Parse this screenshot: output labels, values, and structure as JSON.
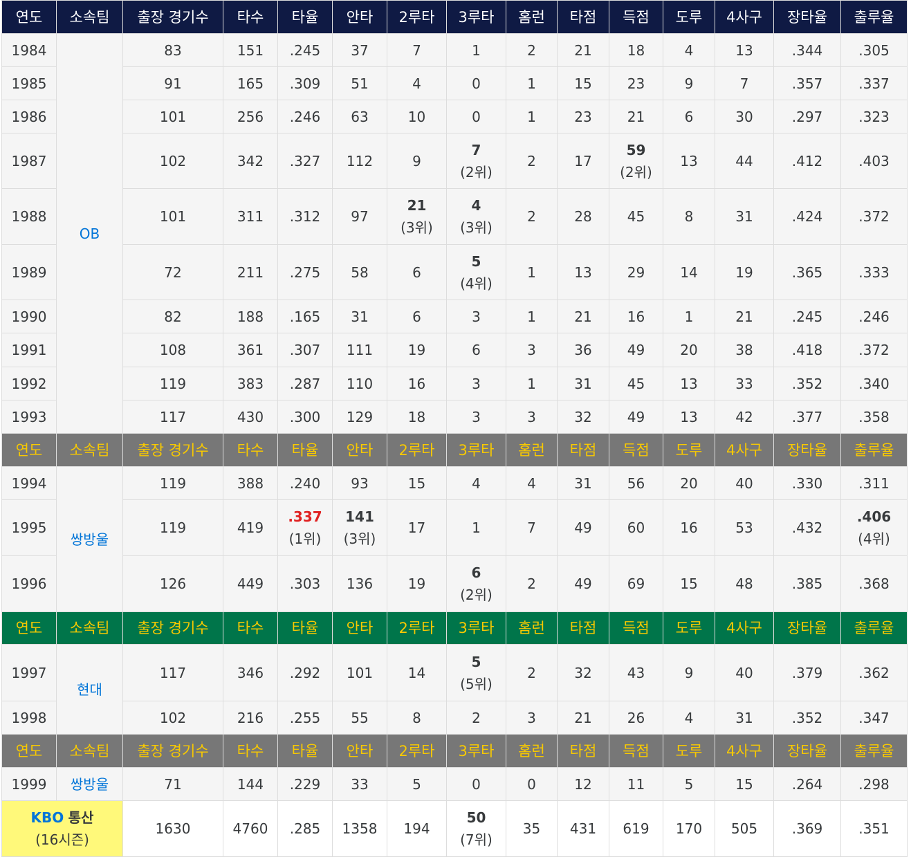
{
  "headers": [
    "연도",
    "소속팀",
    "출장 경기수",
    "타수",
    "타율",
    "안타",
    "2루타",
    "3루타",
    "홈런",
    "타점",
    "득점",
    "도루",
    "4사구",
    "장타율",
    "출루율"
  ],
  "groups": [
    {
      "team": "OB",
      "rows": [
        [
          "1984",
          "83",
          "151",
          ".245",
          "37",
          "7",
          "1",
          "2",
          "21",
          "18",
          "4",
          "13",
          ".344",
          ".305"
        ],
        [
          "1985",
          "91",
          "165",
          ".309",
          "51",
          "4",
          "0",
          "1",
          "15",
          "23",
          "9",
          "7",
          ".357",
          ".337"
        ],
        [
          "1986",
          "101",
          "256",
          ".246",
          "63",
          "10",
          "0",
          "1",
          "23",
          "21",
          "6",
          "30",
          ".297",
          ".323"
        ],
        [
          "1987",
          "102",
          "342",
          ".327",
          "112",
          "9",
          {
            "v": "7",
            "rank": "(2위)"
          },
          "2",
          "17",
          {
            "v": "59",
            "rank": "(2위)"
          },
          "13",
          "44",
          ".412",
          ".403"
        ],
        [
          "1988",
          "101",
          "311",
          ".312",
          "97",
          {
            "v": "21",
            "rank": "(3위)"
          },
          {
            "v": "4",
            "rank": "(3위)"
          },
          "2",
          "28",
          "45",
          "8",
          "31",
          ".424",
          ".372"
        ],
        [
          "1989",
          "72",
          "211",
          ".275",
          "58",
          "6",
          {
            "v": "5",
            "rank": "(4위)"
          },
          "1",
          "13",
          "29",
          "14",
          "19",
          ".365",
          ".333"
        ],
        [
          "1990",
          "82",
          "188",
          ".165",
          "31",
          "6",
          "3",
          "1",
          "21",
          "16",
          "1",
          "21",
          ".245",
          ".246"
        ],
        [
          "1991",
          "108",
          "361",
          ".307",
          "111",
          "19",
          "6",
          "3",
          "36",
          "49",
          "20",
          "38",
          ".418",
          ".372"
        ],
        [
          "1992",
          "119",
          "383",
          ".287",
          "110",
          "16",
          "3",
          "1",
          "31",
          "45",
          "13",
          "33",
          ".352",
          ".340"
        ],
        [
          "1993",
          "117",
          "430",
          ".300",
          "129",
          "18",
          "3",
          "3",
          "32",
          "49",
          "13",
          "42",
          ".377",
          ".358"
        ]
      ]
    },
    {
      "team": "쌍방울",
      "rows": [
        [
          "1994",
          "119",
          "388",
          ".240",
          "93",
          "15",
          "4",
          "4",
          "31",
          "56",
          "20",
          "40",
          ".330",
          ".311"
        ],
        [
          "1995",
          "119",
          "419",
          {
            "v": ".337",
            "rank": "(1위)",
            "red": true
          },
          {
            "v": "141",
            "rank": "(3위)"
          },
          "17",
          "1",
          "7",
          "49",
          "60",
          "16",
          "53",
          ".432",
          {
            "v": ".406",
            "rank": "(4위)"
          }
        ],
        [
          "1996",
          "126",
          "449",
          ".303",
          "136",
          "19",
          {
            "v": "6",
            "rank": "(2위)"
          },
          "2",
          "49",
          "69",
          "15",
          "48",
          ".385",
          ".368"
        ]
      ]
    },
    {
      "team": "현대",
      "rows": [
        [
          "1997",
          "117",
          "346",
          ".292",
          "101",
          "14",
          {
            "v": "5",
            "rank": "(5위)"
          },
          "2",
          "32",
          "43",
          "9",
          "40",
          ".379",
          ".362"
        ],
        [
          "1998",
          "102",
          "216",
          ".255",
          "55",
          "8",
          "2",
          "3",
          "21",
          "26",
          "4",
          "31",
          ".352",
          ".347"
        ]
      ]
    },
    {
      "team": "쌍방울",
      "rows": [
        [
          "1999",
          "71",
          "144",
          ".229",
          "33",
          "5",
          "0",
          "0",
          "12",
          "11",
          "5",
          "15",
          ".264",
          ".298"
        ]
      ]
    }
  ],
  "total": {
    "label_kbo": "KBO",
    "label_rest": "통산",
    "label_seasons": "(16시즌)",
    "values": [
      "1630",
      "4760",
      ".285",
      "1358",
      "194",
      {
        "v": "50",
        "rank": "(7위)"
      },
      "35",
      "431",
      "619",
      "170",
      "505",
      ".369",
      ".351"
    ]
  },
  "colors": {
    "header_navy": "#0f1a44",
    "header_gray": "#777777",
    "header_green": "#00754a",
    "header_gold_text": "#f8c900",
    "team_link": "#0275d8",
    "total_highlight": "#fff97a",
    "rank_red": "#e02020"
  }
}
